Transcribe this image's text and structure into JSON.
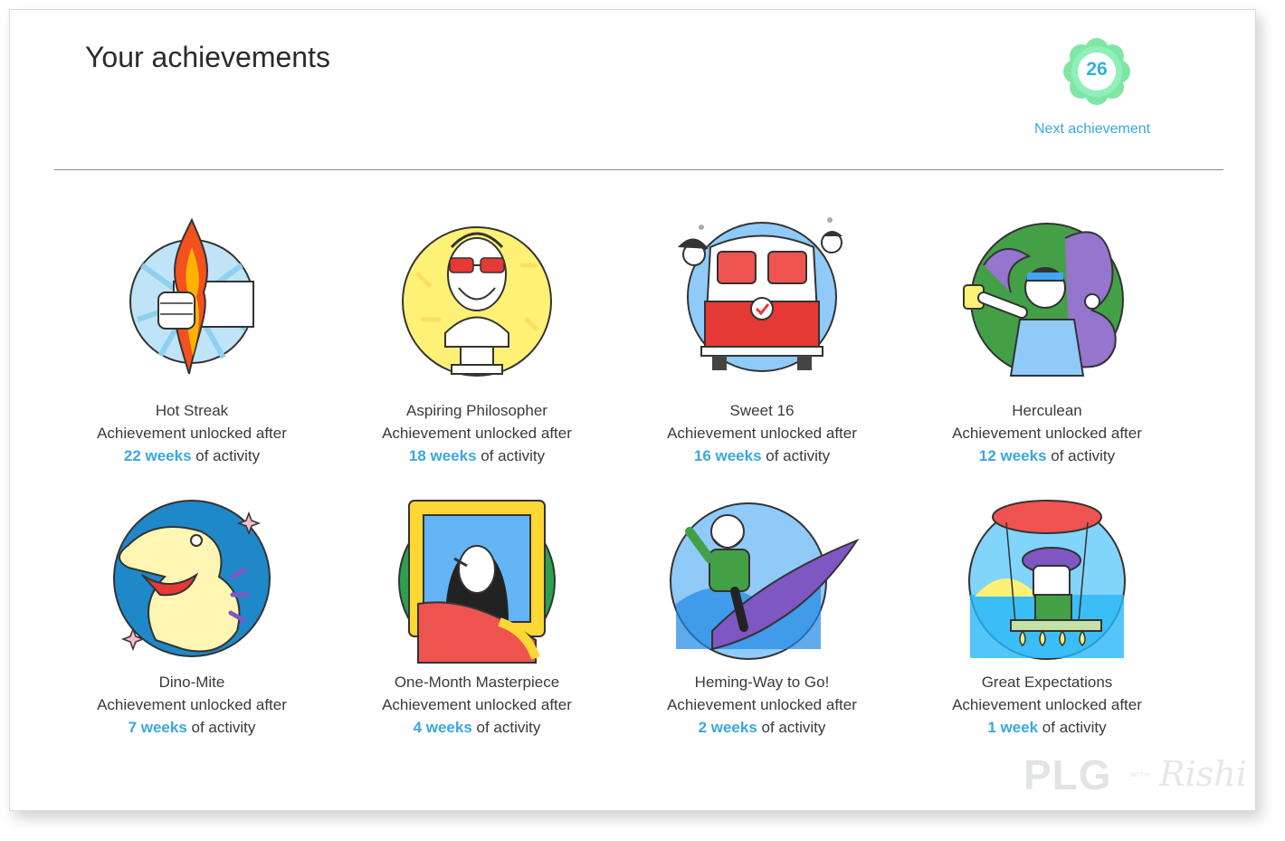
{
  "header": {
    "title": "Your achievements",
    "badge_count": "26",
    "next_link": "Next achievement"
  },
  "colors": {
    "accent": "#3aa7de",
    "badge_ring": "#6be39b",
    "badge_number": "#2eb3d8"
  },
  "achievements": [
    {
      "name": "Hot Streak",
      "subtitle": "Achievement unlocked after",
      "duration": "22 weeks",
      "suffix": " of activity",
      "icon": "flaming-torch-icon"
    },
    {
      "name": "Aspiring Philosopher",
      "subtitle": "Achievement unlocked after",
      "duration": "18 weeks",
      "suffix": " of activity",
      "icon": "philosopher-bust-icon"
    },
    {
      "name": "Sweet 16",
      "subtitle": "Achievement unlocked after",
      "duration": "16 weeks",
      "suffix": " of activity",
      "icon": "camper-van-icon"
    },
    {
      "name": "Herculean",
      "subtitle": "Achievement unlocked after",
      "duration": "12 weeks",
      "suffix": " of activity",
      "icon": "hero-with-serpents-icon"
    },
    {
      "name": "Dino-Mite",
      "subtitle": "Achievement unlocked after",
      "duration": "7 weeks",
      "suffix": " of activity",
      "icon": "dinosaur-icon"
    },
    {
      "name": "One-Month Masterpiece",
      "subtitle": "Achievement unlocked after",
      "duration": "4 weeks",
      "suffix": " of activity",
      "icon": "framed-portrait-icon"
    },
    {
      "name": "Heming-Way to Go!",
      "subtitle": "Achievement unlocked after",
      "duration": "2 weeks",
      "suffix": " of activity",
      "icon": "fisherman-marlin-icon"
    },
    {
      "name": "Great Expectations",
      "subtitle": "Achievement unlocked after",
      "duration": "1 week",
      "suffix": " of activity",
      "icon": "hot-air-balloon-icon"
    }
  ],
  "watermark": {
    "brand": "PLG",
    "with": "WITH",
    "author": "Rishi"
  }
}
